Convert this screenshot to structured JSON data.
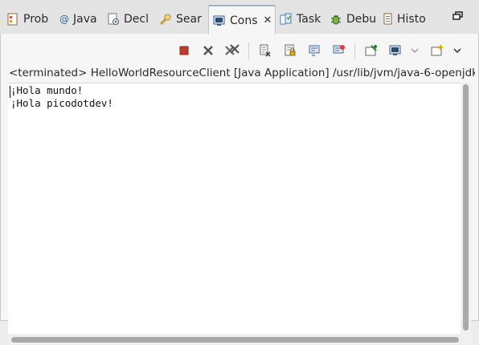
{
  "tabs": [
    {
      "label": "Prob",
      "icon": "problems-icon"
    },
    {
      "label": "Java",
      "icon": "javadoc-icon"
    },
    {
      "label": "Decl",
      "icon": "declaration-icon"
    },
    {
      "label": "Sear",
      "icon": "search-icon"
    },
    {
      "label": "Cons",
      "icon": "console-icon",
      "active": true,
      "close": "✕"
    },
    {
      "label": "Task",
      "icon": "tasks-icon"
    },
    {
      "label": "Debu",
      "icon": "debug-icon"
    },
    {
      "label": "Histo",
      "icon": "history-icon"
    }
  ],
  "console": {
    "description": "<terminated> HelloWorldResourceClient [Java Application] /usr/lib/jvm/java-6-openjdk/b",
    "lines": [
      "¡Hola mundo!",
      "¡Hola picodotdev!"
    ]
  },
  "colors": {
    "accent": "#9fb3cd",
    "terminate_red": "#c0392b",
    "panel_bg": "#f6f6f6",
    "console_bg": "#ffffff"
  }
}
